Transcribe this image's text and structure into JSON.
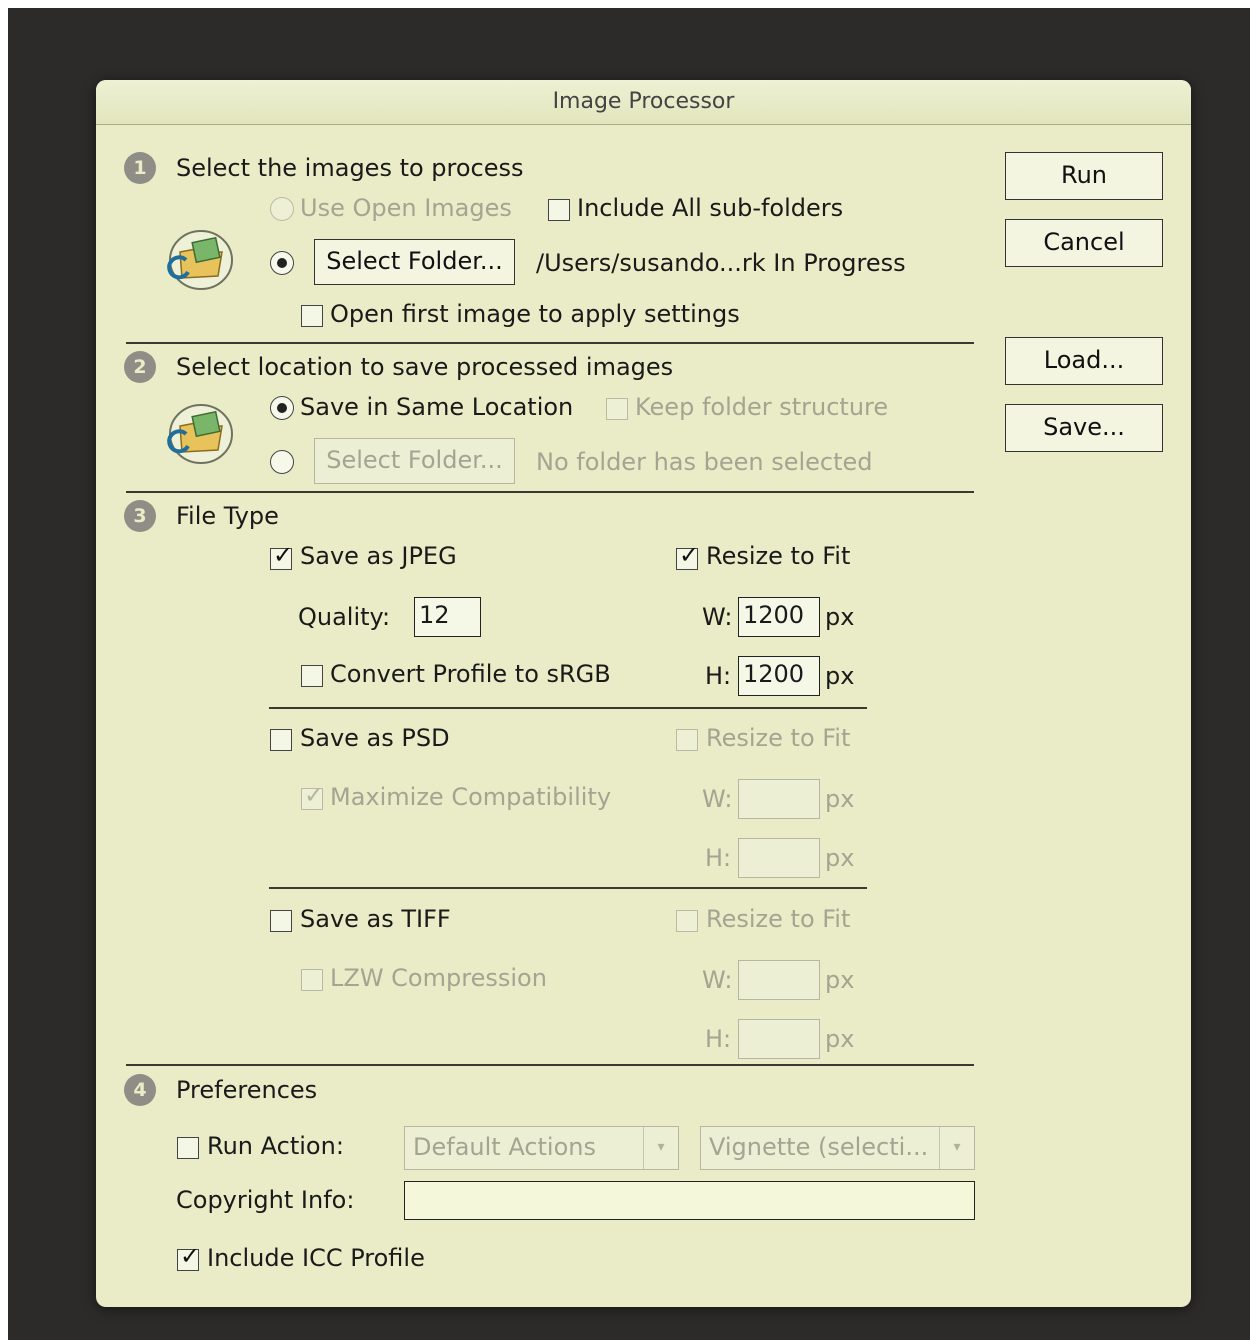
{
  "window": {
    "title": "Image Processor"
  },
  "section1": {
    "number": "1",
    "heading": "Select the images to process",
    "use_open_images": {
      "label": "Use Open Images",
      "selected": false,
      "enabled": false
    },
    "include_subfolders": {
      "label": "Include All sub-folders",
      "checked": false
    },
    "select_folder": {
      "label": "Select Folder...",
      "selected": true
    },
    "folder_path": "/Users/susando...rk In Progress",
    "open_first_image": {
      "label": "Open first image to apply settings",
      "checked": false
    }
  },
  "section2": {
    "number": "2",
    "heading": "Select location to save processed images",
    "same_location": {
      "label": "Save in Same Location",
      "selected": true
    },
    "keep_structure": {
      "label": "Keep folder structure",
      "checked": false,
      "enabled": false
    },
    "select_folder": {
      "label": "Select Folder...",
      "selected": false,
      "enabled": false
    },
    "folder_status": "No folder has been selected"
  },
  "section3": {
    "number": "3",
    "heading": "File Type",
    "jpeg": {
      "label": "Save as JPEG",
      "checked": true,
      "quality_label": "Quality:",
      "quality": "12",
      "convert_label": "Convert Profile to sRGB",
      "convert_checked": false,
      "resize_label": "Resize to Fit",
      "resize_checked": true,
      "w_label": "W:",
      "w_value": "1200",
      "h_label": "H:",
      "h_value": "1200",
      "unit": "px"
    },
    "psd": {
      "label": "Save as PSD",
      "checked": false,
      "max_compat_label": "Maximize Compatibility",
      "max_compat_checked": true,
      "resize_label": "Resize to Fit",
      "resize_checked": false,
      "w_label": "W:",
      "w_value": "",
      "h_label": "H:",
      "h_value": "",
      "unit": "px"
    },
    "tiff": {
      "label": "Save as TIFF",
      "checked": false,
      "lzw_label": "LZW Compression",
      "lzw_checked": false,
      "resize_label": "Resize to Fit",
      "resize_checked": false,
      "w_label": "W:",
      "w_value": "",
      "h_label": "H:",
      "h_value": "",
      "unit": "px"
    }
  },
  "section4": {
    "number": "4",
    "heading": "Preferences",
    "run_action": {
      "label": "Run Action:",
      "checked": false,
      "set": "Default Actions",
      "action": "Vignette (selecti..."
    },
    "copyright": {
      "label": "Copyright Info:",
      "value": ""
    },
    "icc": {
      "label": "Include ICC Profile",
      "checked": true
    }
  },
  "buttons": {
    "run": "Run",
    "cancel": "Cancel",
    "load": "Load...",
    "save": "Save..."
  },
  "glyphs": {
    "check": "✓",
    "arrow": "▾"
  },
  "colors": {
    "dialog_bg": "#e9ecc6",
    "backdrop": "#2d2b29",
    "disabled_text": "#a3a592"
  }
}
